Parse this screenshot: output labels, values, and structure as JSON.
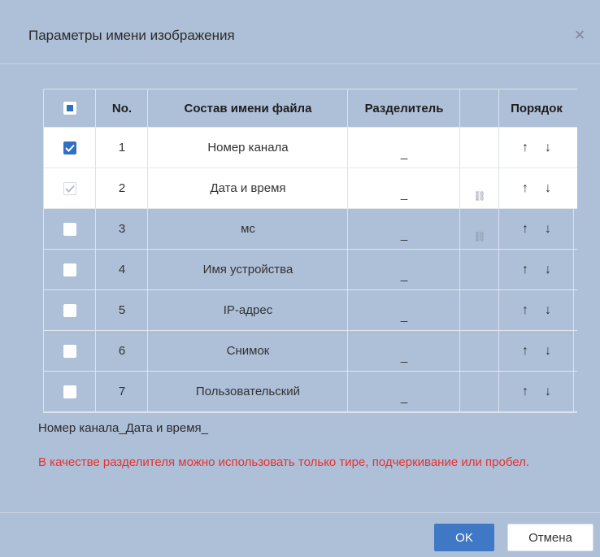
{
  "dialog": {
    "title": "Параметры имени изображения",
    "close_icon": "×"
  },
  "table": {
    "headers": {
      "no": "No.",
      "name": "Состав имени файла",
      "separator": "Разделитель",
      "order": "Порядок"
    },
    "rows": [
      {
        "no": "1",
        "name": "Номер канала",
        "separator": "_",
        "state": "checked",
        "link": false
      },
      {
        "no": "2",
        "name": "Дата и время",
        "separator": "_",
        "state": "disabled-checked",
        "link": true
      },
      {
        "no": "3",
        "name": "мс",
        "separator": "_",
        "state": "unchecked",
        "link": true
      },
      {
        "no": "4",
        "name": "Имя устройства",
        "separator": "_",
        "state": "unchecked",
        "link": false
      },
      {
        "no": "5",
        "name": "IP-адрес",
        "separator": "_",
        "state": "unchecked",
        "link": false
      },
      {
        "no": "6",
        "name": "Снимок",
        "separator": "_",
        "state": "unchecked",
        "link": false
      },
      {
        "no": "7",
        "name": "Пользовательский",
        "separator": "_",
        "state": "unchecked",
        "link": false
      }
    ],
    "link_icon": "⛓",
    "up_arrow": "↑",
    "down_arrow": "↓"
  },
  "preview": "Номер канала_Дата и время_",
  "warning": "В качестве разделителя можно использовать только тире, подчеркивание или пробел.",
  "buttons": {
    "ok": "OK",
    "cancel": "Отмена"
  },
  "colors": {
    "accent": "#3f78c4",
    "warning": "#e8302f",
    "background": "#aebfd8"
  }
}
